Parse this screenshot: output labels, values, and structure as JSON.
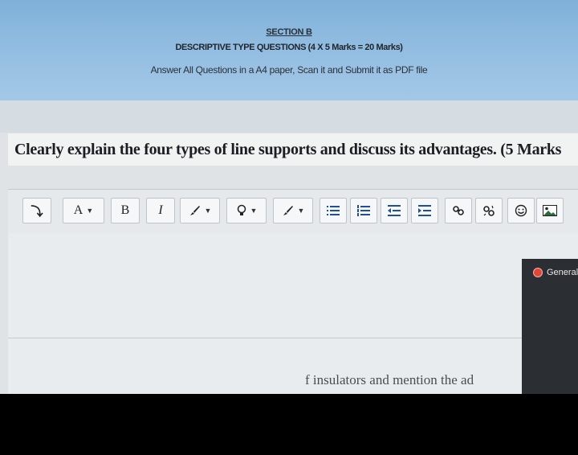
{
  "header": {
    "section": "SECTION B",
    "title": "DESCRIPTIVE TYPE QUESTIONS (4 X 5 Marks = 20 Marks)",
    "instruction": "Answer All Questions in a A4 paper, Scan it and Submit it as PDF file"
  },
  "question": {
    "text": "Clearly explain the four types of line supports and discuss its advantages.  (5 Marks"
  },
  "toolbar": {
    "items": [
      {
        "name": "toggle-toolbar",
        "icon": "expand-icon",
        "glyph": "⤵"
      },
      {
        "name": "font-size",
        "label": "A"
      },
      {
        "name": "bold",
        "label": "B"
      },
      {
        "name": "italic",
        "label": "I"
      },
      {
        "name": "text-color",
        "icon": "brush-icon"
      },
      {
        "name": "highlight",
        "icon": "bulb-icon"
      },
      {
        "name": "background-color",
        "icon": "brush-icon"
      },
      {
        "name": "unordered-list",
        "icon": "list-icon"
      },
      {
        "name": "ordered-list",
        "icon": "numbered-list-icon"
      },
      {
        "name": "outdent",
        "icon": "outdent-icon"
      },
      {
        "name": "indent",
        "icon": "indent-icon"
      },
      {
        "name": "link",
        "icon": "link-icon"
      },
      {
        "name": "unlink",
        "icon": "unlink-icon"
      },
      {
        "name": "emoji",
        "icon": "smiley-icon"
      },
      {
        "name": "image",
        "icon": "image-icon"
      }
    ]
  },
  "side_panel": {
    "label": "General"
  },
  "next_question_partial": "f insulators and mention the ad"
}
